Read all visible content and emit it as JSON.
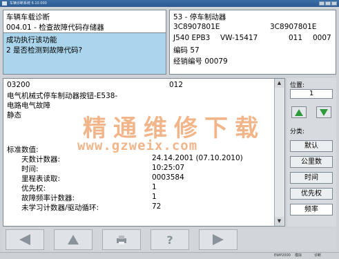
{
  "window": {
    "title": "车辆诊断系统 6.10.000"
  },
  "left_panel": {
    "title": "车辆车载诊断",
    "function": "004.01 - 检查故障代码存储器",
    "message_line1": "成功执行该功能",
    "message_line2": "2 是否检测到故障代码?"
  },
  "right_panel": {
    "system": "53 - 停车制动器",
    "part_no_left": "3C8907801E",
    "part_no_right": "3C8907801E",
    "component": "J540 EPB3",
    "version": "VW-15417",
    "v1": "011",
    "v2": "0007",
    "code_label": "编码 57",
    "dealer_label": "经销编号 00079"
  },
  "fault": {
    "code": "03200",
    "sub": "012",
    "desc1": "电气机械式停车制动器按钮-E538-",
    "desc2": "电路电气故障",
    "desc3": "静态"
  },
  "env": {
    "heading": "标准数值:",
    "rows": [
      {
        "label": "天数计数器:",
        "value": "24.14.2001 (07.10.2010)"
      },
      {
        "label": "时间:",
        "value": "10:25:07"
      },
      {
        "label": "里程表读取:",
        "value": "0003584"
      },
      {
        "label": "优先权:",
        "value": "1"
      },
      {
        "label": "故障频率计数器:",
        "value": "1"
      },
      {
        "label": "未学习计数器/驱动循环:",
        "value": "72"
      }
    ]
  },
  "side": {
    "position_label": "位置:",
    "position_value": "1",
    "category_label": "分类:",
    "buttons": [
      "默认",
      "公里数",
      "时间",
      "优先权",
      "频率"
    ]
  },
  "watermark": {
    "line1": "精通维修下载",
    "line2": "www.gzweix.com"
  },
  "statusbar": {
    "left": "EWP2000",
    "mid": "模拟",
    "right": "诊断"
  },
  "colors": {
    "highlight": "#abd5ec",
    "accent_green": "#2e9a3a",
    "watermark": "#e87a2a"
  }
}
